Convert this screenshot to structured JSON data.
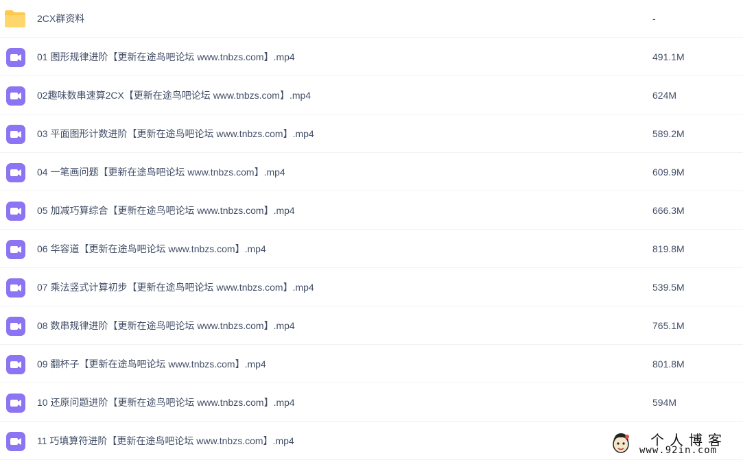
{
  "files": [
    {
      "type": "folder",
      "icon": "folder-icon",
      "name": "2CX群资料",
      "size": "-"
    },
    {
      "type": "video",
      "icon": "video-file-icon",
      "name": "01 图形规律进阶【更新在途鸟吧论坛 www.tnbzs.com】.mp4",
      "size": "491.1M"
    },
    {
      "type": "video",
      "icon": "video-file-icon",
      "name": "02趣味数串速算2CX【更新在途鸟吧论坛 www.tnbzs.com】.mp4",
      "size": "624M"
    },
    {
      "type": "video",
      "icon": "video-file-icon",
      "name": "03 平面图形计数进阶【更新在途鸟吧论坛 www.tnbzs.com】.mp4",
      "size": "589.2M"
    },
    {
      "type": "video",
      "icon": "video-file-icon",
      "name": "04 一笔画问题【更新在途鸟吧论坛 www.tnbzs.com】.mp4",
      "size": "609.9M"
    },
    {
      "type": "video",
      "icon": "video-file-icon",
      "name": "05 加减巧算综合【更新在途鸟吧论坛 www.tnbzs.com】.mp4",
      "size": "666.3M"
    },
    {
      "type": "video",
      "icon": "video-file-icon",
      "name": "06 华容道【更新在途鸟吧论坛 www.tnbzs.com】.mp4",
      "size": "819.8M"
    },
    {
      "type": "video",
      "icon": "video-file-icon",
      "name": "07 乘法竖式计算初步【更新在途鸟吧论坛 www.tnbzs.com】.mp4",
      "size": "539.5M"
    },
    {
      "type": "video",
      "icon": "video-file-icon",
      "name": "08 数串规律进阶【更新在途鸟吧论坛 www.tnbzs.com】.mp4",
      "size": "765.1M"
    },
    {
      "type": "video",
      "icon": "video-file-icon",
      "name": "09 翻杯子【更新在途鸟吧论坛 www.tnbzs.com】.mp4",
      "size": "801.8M"
    },
    {
      "type": "video",
      "icon": "video-file-icon",
      "name": "10 还原问题进阶【更新在途鸟吧论坛 www.tnbzs.com】.mp4",
      "size": "594M"
    },
    {
      "type": "video",
      "icon": "video-file-icon",
      "name": "11 巧填算符进阶【更新在途鸟吧论坛 www.tnbzs.com】.mp4",
      "size": ""
    }
  ],
  "watermark": {
    "title": "个人博客",
    "url": "www.92in.com"
  },
  "colors": {
    "folder": "#ffc94d",
    "video": "#8c74f2",
    "text": "#424e67",
    "divider": "#f1f2f5"
  }
}
